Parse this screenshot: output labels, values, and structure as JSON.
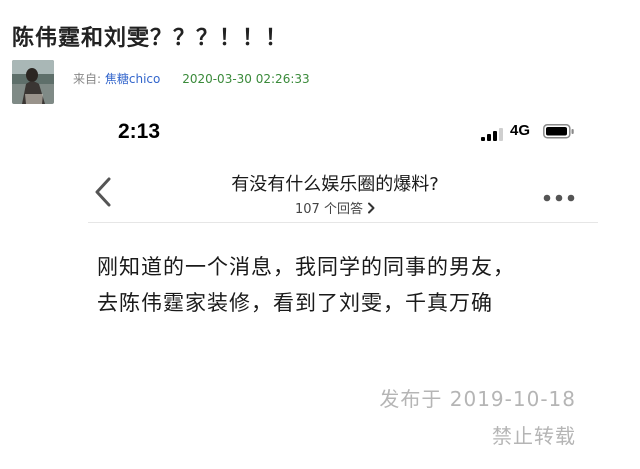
{
  "post": {
    "title": "陈伟霆和刘雯？？？！！！",
    "from_label": "来自:",
    "author": "焦糖chico",
    "timestamp": "2020-03-30 02:26:33"
  },
  "screenshot": {
    "status_bar": {
      "time": "2:13",
      "network": "4G",
      "icons": [
        "signal-bars-icon",
        "battery-icon"
      ]
    },
    "nav": {
      "back_icon": "chevron-left-icon",
      "question_title": "有没有什么娱乐圈的爆料?",
      "answer_count_text": "107 个回答",
      "answer_count_icon": "chevron-right-icon",
      "more_icon": "more-dots-icon"
    },
    "answer": {
      "lines": [
        "刚知道的一个消息，我同学的同事的男友，",
        "去陈伟霆家装修，看到了刘雯，千真万确"
      ],
      "published": "发布于 2019-10-18",
      "copyright": "禁止转载"
    }
  },
  "colors": {
    "author_link": "#3366cc",
    "timestamp": "#3a8a3a",
    "muted_text": "#b5b5b5"
  }
}
